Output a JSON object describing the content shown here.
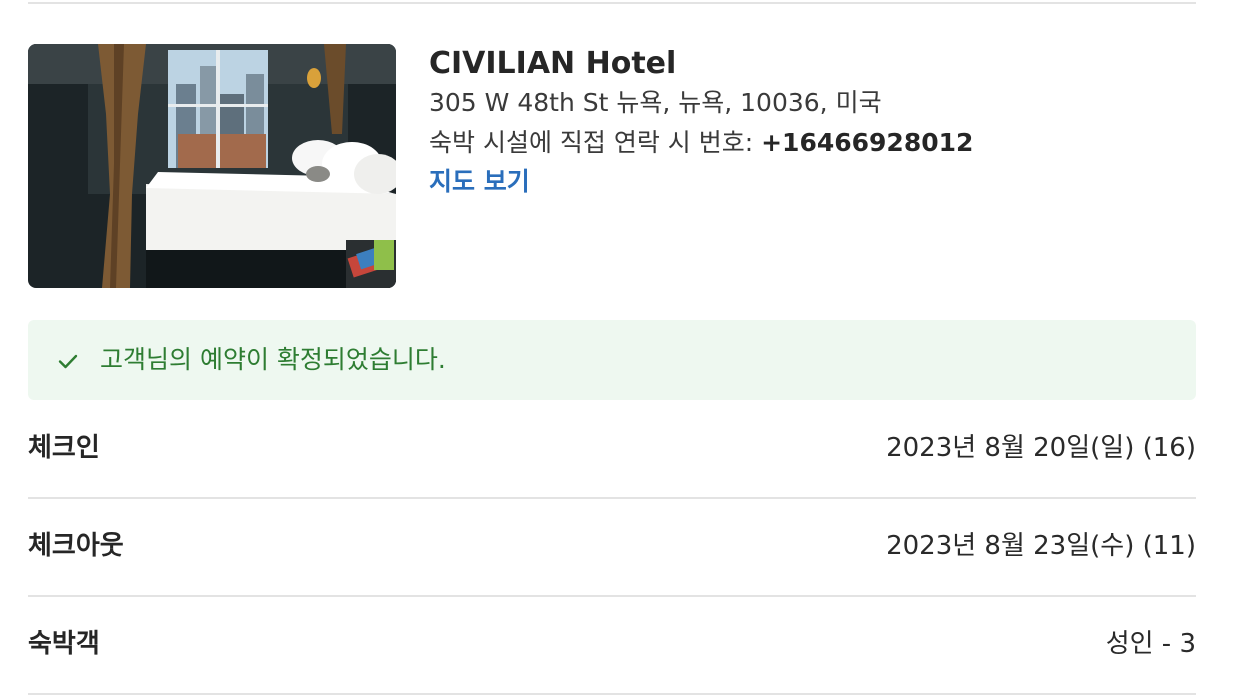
{
  "hotel": {
    "name": "CIVILIAN Hotel",
    "address": "305 W 48th St 뉴욕, 뉴욕, 10036, 미국",
    "phone_prefix": "숙박 시설에 직접 연락 시 번호: ",
    "phone": "+16466928012",
    "map_link": "지도 보기",
    "link_color": "#2a6ebb"
  },
  "confirmation": {
    "message": "고객님의 예약이 확정되었습니다.",
    "icon": "check-icon",
    "color": "#2e7d32",
    "background": "#eef8f0"
  },
  "details": {
    "checkin": {
      "label": "체크인",
      "value": "2023년 8월 20일(일) (16)"
    },
    "checkout": {
      "label": "체크아웃",
      "value": "2023년 8월 23일(수) (11)"
    },
    "guests": {
      "label": "숙박객",
      "value": "성인 - 3"
    }
  }
}
